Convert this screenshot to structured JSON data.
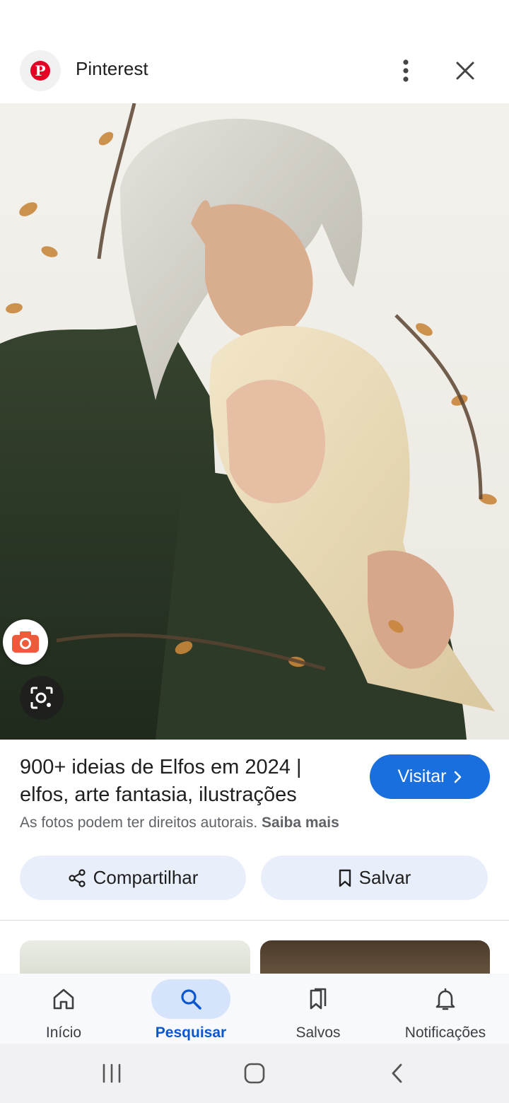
{
  "header": {
    "site_name": "Pinterest"
  },
  "result": {
    "title": "900+ ideias de Elfos em 2024 | elfos, arte fantasia, ilustrações",
    "copyright_text": "As fotos podem ter direitos autorais.",
    "learn_more": "Saiba mais",
    "visit_label": "Visitar"
  },
  "actions": {
    "share_label": "Compartilhar",
    "save_label": "Salvar"
  },
  "bottom_nav": {
    "items": [
      {
        "label": "Início",
        "icon": "home-icon"
      },
      {
        "label": "Pesquisar",
        "icon": "search-icon",
        "active": true
      },
      {
        "label": "Salvos",
        "icon": "bookmarks-icon"
      },
      {
        "label": "Notificações",
        "icon": "bell-icon"
      }
    ]
  },
  "colors": {
    "accent": "#1a6fde",
    "pinterest_red": "#e60023",
    "active_nav": "#0b57d0"
  }
}
